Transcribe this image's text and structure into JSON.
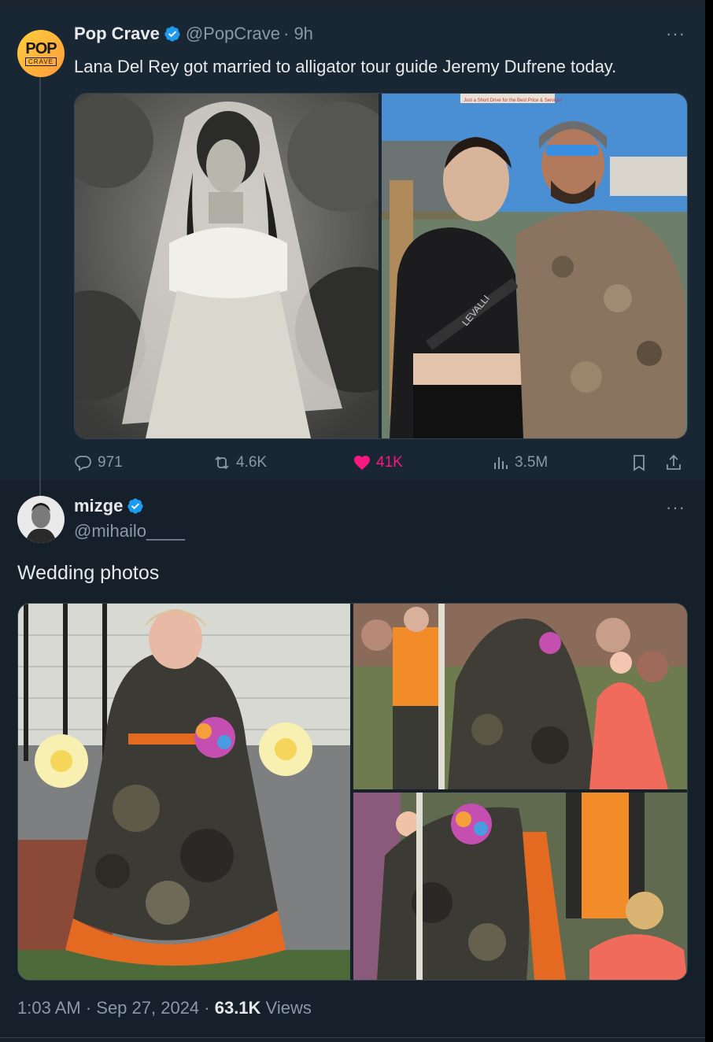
{
  "tweet": {
    "author": {
      "name": "Pop Crave",
      "handle": "@PopCrave",
      "time": "· 9h",
      "avatar_text": "POP",
      "avatar_subtext": "CRAVE"
    },
    "text": "Lana Del Rey got married to alligator tour guide Jeremy Dufrene today.",
    "more": "···",
    "stats": {
      "replies": "971",
      "reposts": "4.6K",
      "likes": "41K",
      "views": "3.5M"
    },
    "photo_sign_text": "Just a Short Drive for the Best Price & Service!",
    "photo_shirt_text": "LEVALLI"
  },
  "reply": {
    "author": {
      "name": "mizge",
      "handle": "@mihailo____"
    },
    "more": "···",
    "text": "Wedding photos",
    "timestamp": "1:03 AM · Sep 27, 2024 · ",
    "views_count": "63.1K",
    "views_label": " Views"
  },
  "colors": {
    "background": "#15202b",
    "accent": "#1d9bf0",
    "like": "#f91880",
    "muted": "#8b98a5"
  }
}
